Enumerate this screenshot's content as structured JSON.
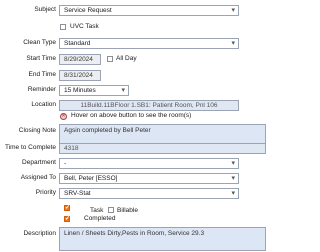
{
  "subject": {
    "label": "Subject",
    "value": "Service Request"
  },
  "uvc_task": {
    "label": "UVC Task",
    "checked": false
  },
  "clean_type": {
    "label": "Clean Type",
    "value": "Standard"
  },
  "start_time": {
    "label": "Start Time",
    "value": "8/29/2024"
  },
  "all_day": {
    "label": "All Day",
    "checked": false
  },
  "end_time": {
    "label": "End Time",
    "value": "8/31/2024"
  },
  "reminder": {
    "label": "Reminder",
    "value": "15 Minutes"
  },
  "location": {
    "label": "Location",
    "value": "11Build.11BFloor 1.SB1: Patient Room, Pnl 106"
  },
  "hover_hint": {
    "text": "Hover on above button to see the room(s)"
  },
  "closing_note": {
    "label": "Closing Note",
    "value": "Agsin completed by Bell Peter"
  },
  "time_to_complete": {
    "label": "Time to Complete",
    "value": "4318"
  },
  "department": {
    "label": "Department",
    "value": "-"
  },
  "assigned_to": {
    "label": "Assigned To",
    "value": "Bell, Peter [ESSO]"
  },
  "priority": {
    "label": "Priority",
    "value": "SRV-Stat"
  },
  "task": {
    "label": "Task",
    "checked": true
  },
  "billable": {
    "label": "Billable",
    "checked": false
  },
  "completed": {
    "label": "Completed"
  },
  "description": {
    "label": "Description",
    "value": "Linen / Sheets Dirty,Pests in Room, Service 29.3"
  }
}
